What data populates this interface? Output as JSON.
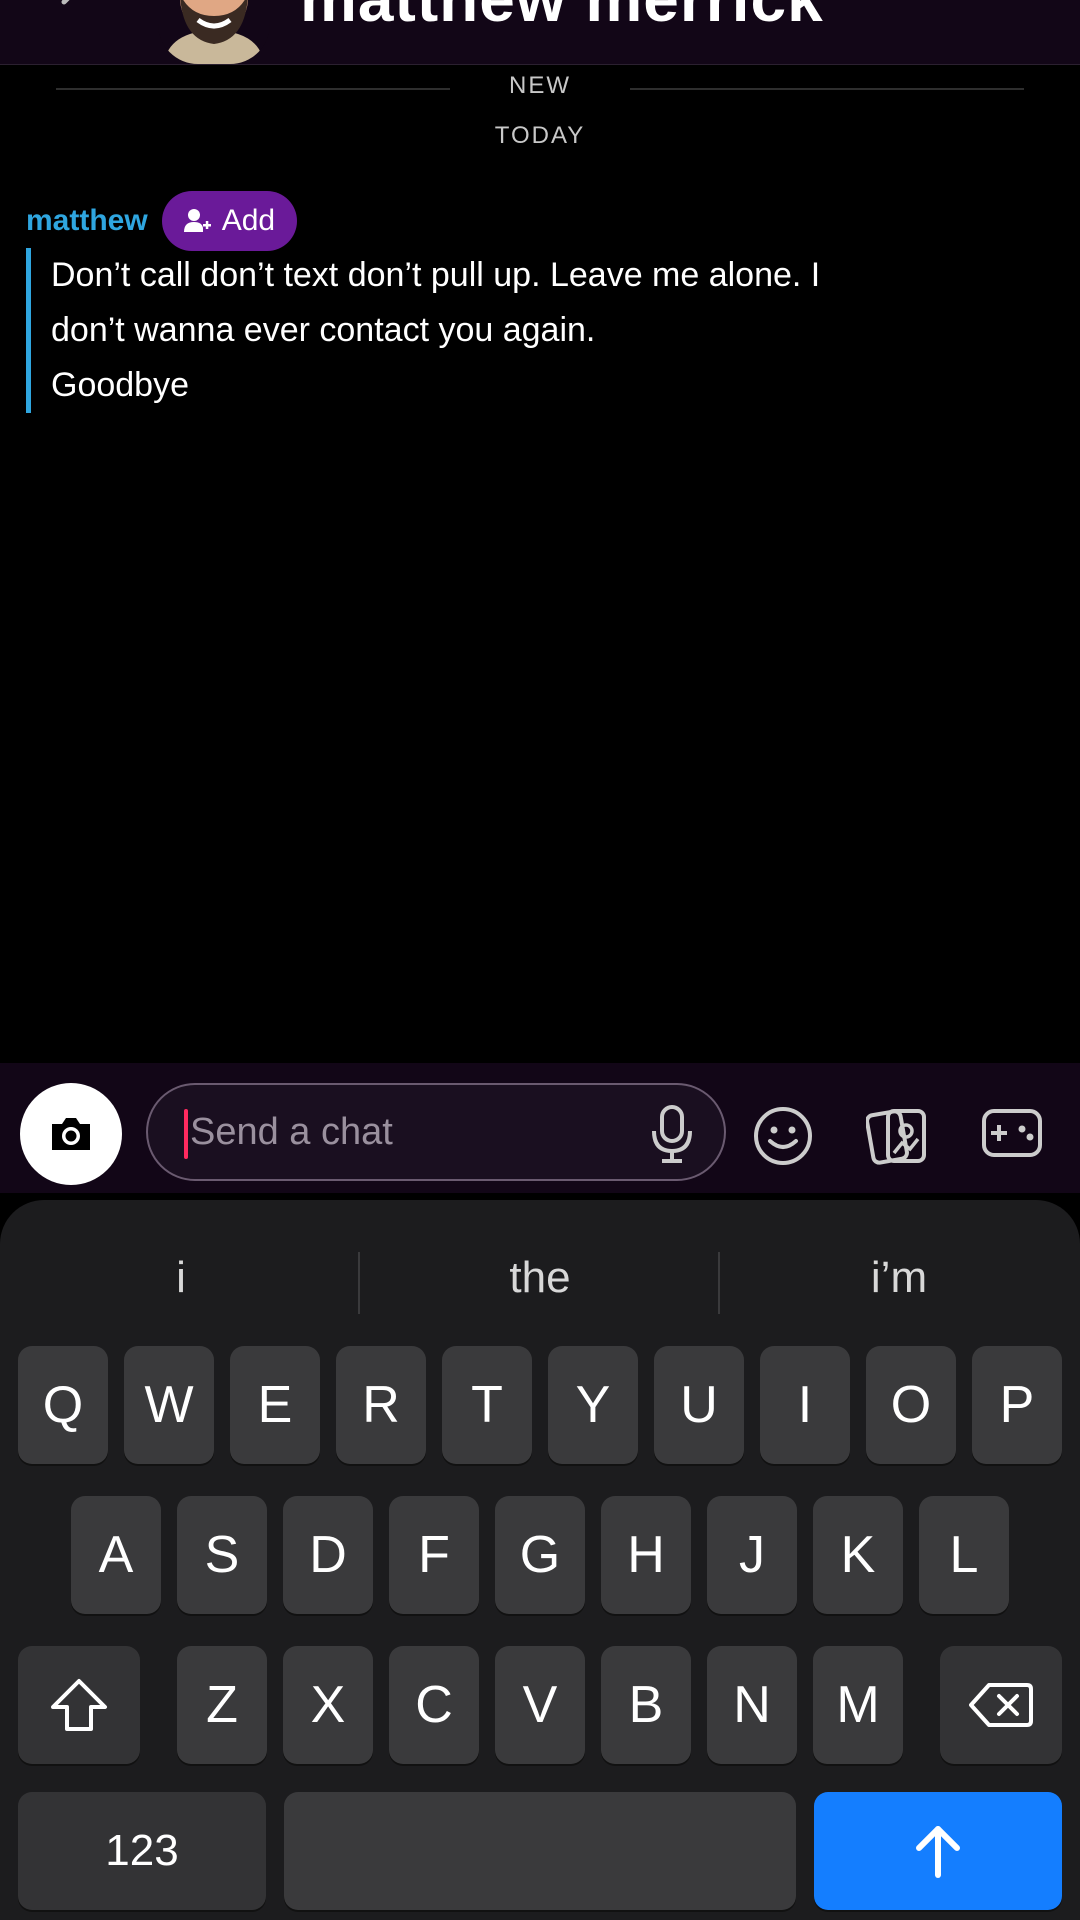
{
  "header": {
    "title": "matthew merrick",
    "back_icon": "chevron-left-icon",
    "avatar_icon": "bitmoji-avatar"
  },
  "chat": {
    "new_label": "NEW",
    "today_label": "TODAY",
    "message": {
      "sender": "matthew",
      "add_label": "Add",
      "text": "Don’t call don’t text don’t pull up. Leave me alone. I\ndon’t wanna ever contact you again.\nGoodbye"
    }
  },
  "input_bar": {
    "placeholder": "Send a chat",
    "icons": [
      "camera-icon",
      "mic-icon",
      "emoji-icon",
      "sticker-icon",
      "game-icon"
    ]
  },
  "keyboard": {
    "suggestions": [
      "i",
      "the",
      "i’m"
    ],
    "row1": [
      "Q",
      "W",
      "E",
      "R",
      "T",
      "Y",
      "U",
      "I",
      "O",
      "P"
    ],
    "row2": [
      "A",
      "S",
      "D",
      "F",
      "G",
      "H",
      "J",
      "K",
      "L"
    ],
    "row3": [
      "Z",
      "X",
      "C",
      "V",
      "B",
      "N",
      "M"
    ],
    "numbers_label": "123",
    "space_label": "",
    "colors": {
      "send": "#147eff",
      "accent": "#2fa6e0",
      "add": "#6a1a99",
      "caret": "#ff2a5f"
    }
  }
}
